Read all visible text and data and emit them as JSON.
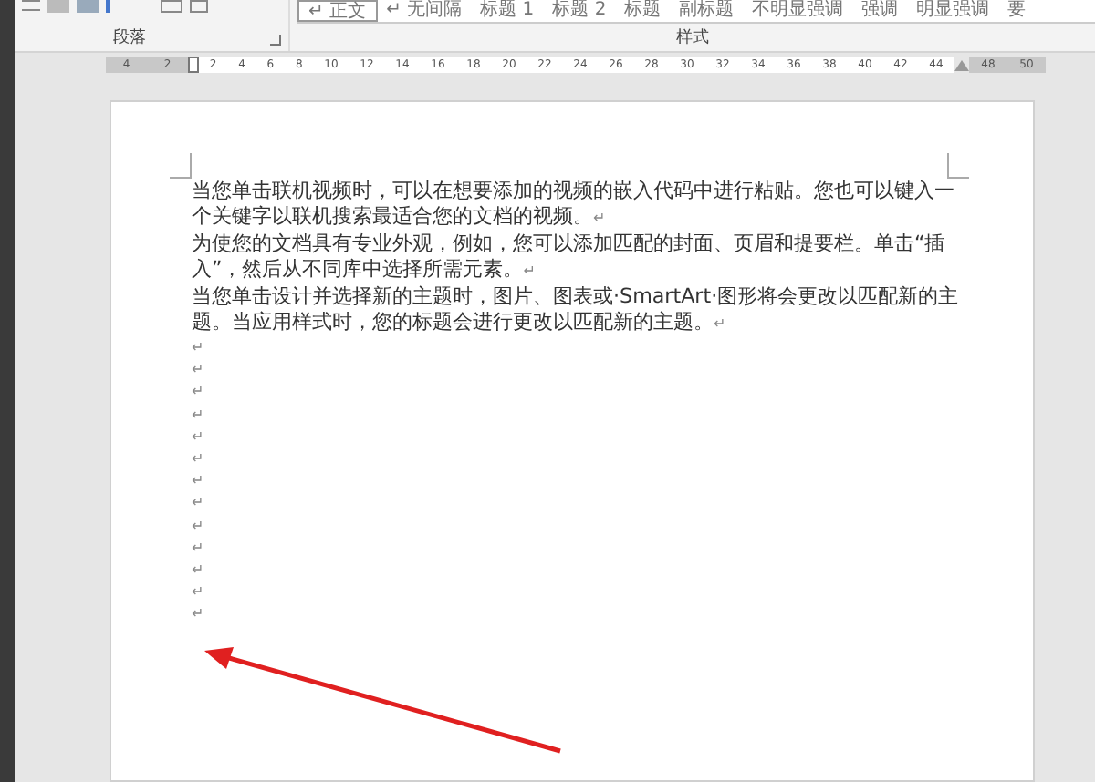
{
  "ribbon": {
    "groups": [
      {
        "label": "段落"
      },
      {
        "label": "样式"
      }
    ],
    "styles": [
      {
        "label": "↵ 正文",
        "selected": true
      },
      {
        "label": "↵ 无间隔",
        "selected": false
      },
      {
        "label": "标题 1",
        "selected": false
      },
      {
        "label": "标题 2",
        "selected": false
      },
      {
        "label": "标题",
        "selected": false
      },
      {
        "label": "副标题",
        "selected": false
      },
      {
        "label": "不明显强调",
        "selected": false
      },
      {
        "label": "强调",
        "selected": false
      },
      {
        "label": "明显强调",
        "selected": false
      },
      {
        "label": "要",
        "selected": false
      }
    ]
  },
  "ruler": {
    "left_numbers": [
      "4",
      "2"
    ],
    "numbers": [
      "2",
      "4",
      "6",
      "8",
      "10",
      "12",
      "14",
      "16",
      "18",
      "20",
      "22",
      "24",
      "26",
      "28",
      "30",
      "32",
      "34",
      "36",
      "38",
      "40",
      "42",
      "44"
    ],
    "right_numbers": [
      "48",
      "50"
    ]
  },
  "document": {
    "paragraphs": [
      {
        "text": "当您单击联机视频时，可以在想要添加的视频的嵌入代码中进行粘贴。您也可以键入一个关键字以联机搜索最适合您的文档的视频。",
        "mark": "↵"
      },
      {
        "text": "为使您的文档具有专业外观，例如，您可以添加匹配的封面、页眉和提要栏。单击“插入”，然后从不同库中选择所需元素。",
        "mark": "↵"
      },
      {
        "text": "当您单击设计并选择新的主题时，图片、图表或·SmartArt·图形将会更改以匹配新的主题。当应用样式时，您的标题会进行更改以匹配新的主题。",
        "mark": "↵"
      }
    ],
    "empty_paragraphs": [
      "↵",
      "↵",
      "↵",
      "↵",
      "↵",
      "↵",
      "↵",
      "↵",
      "↵",
      "↵",
      "↵",
      "↵",
      "↵"
    ]
  }
}
